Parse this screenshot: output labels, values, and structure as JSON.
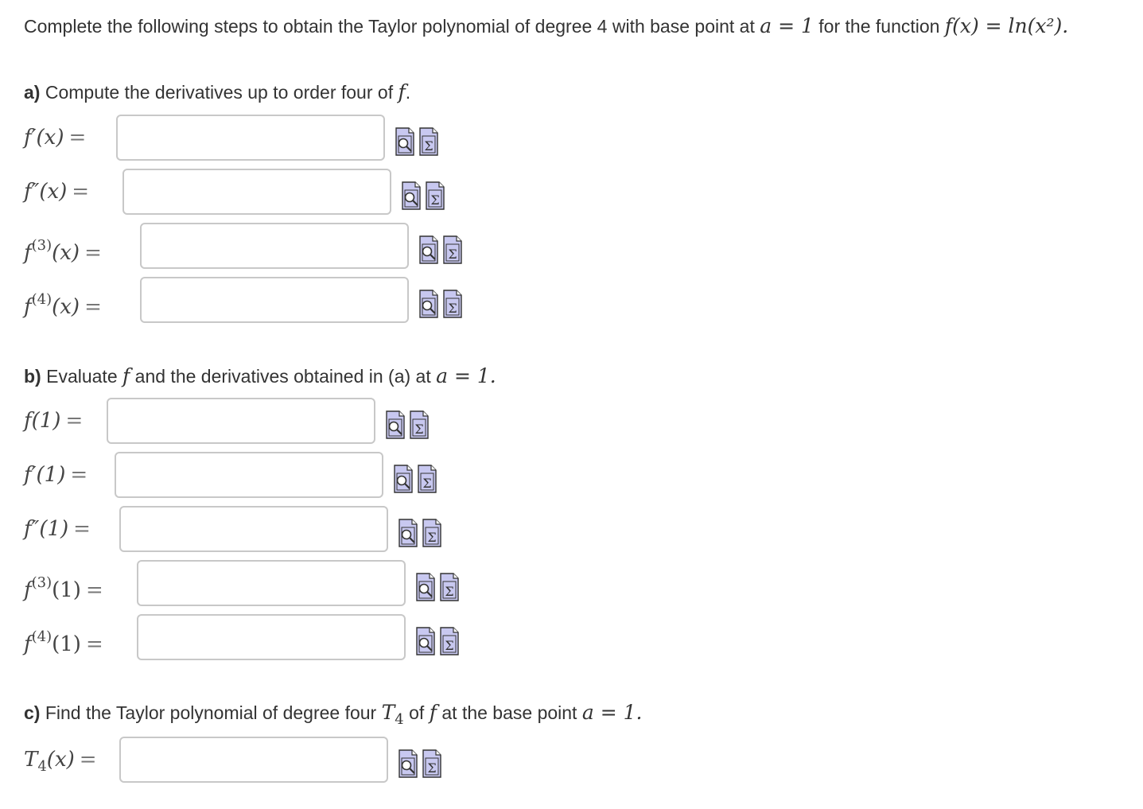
{
  "intro": {
    "text": "Complete the following steps to obtain the Taylor polynomial of degree 4 with base point at",
    "base_point": "a = 1",
    "mid_text": "for the function",
    "function": "f(x) = ln(x²)."
  },
  "sections": {
    "a": {
      "tag": "a)",
      "text": "Compute the derivatives up to order four of",
      "symbol": "f",
      "end": "."
    },
    "b": {
      "tag": "b)",
      "text_1": "Evaluate",
      "symbol": "f",
      "text_2": "and the derivatives obtained in (a) at",
      "point": "a = 1."
    },
    "c": {
      "tag": "c)",
      "text_1": "Find the Taylor polynomial of degree four",
      "poly": "T",
      "poly_sub": "4",
      "text_2": "of",
      "symbol": "f",
      "text_3": "at the base point",
      "point": "a = 1."
    }
  },
  "rows": {
    "d1": {
      "label": "f′(x)",
      "eq": "=",
      "value": ""
    },
    "d2": {
      "label": "f″(x)",
      "eq": "=",
      "value": ""
    },
    "d3": {
      "label_base": "f",
      "label_sup": "(3)",
      "label_arg": "(x)",
      "eq": "=",
      "value": ""
    },
    "d4": {
      "label_base": "f",
      "label_sup": "(4)",
      "label_arg": "(x)",
      "eq": "=",
      "value": ""
    },
    "e0": {
      "label": "f(1)",
      "eq": "=",
      "value": ""
    },
    "e1": {
      "label": "f′(1)",
      "eq": "=",
      "value": ""
    },
    "e2": {
      "label": "f″(1)",
      "eq": "=",
      "value": ""
    },
    "e3": {
      "label_base": "f",
      "label_sup": "(3)",
      "label_arg": "(1)",
      "eq": "=",
      "value": ""
    },
    "e4": {
      "label_base": "f",
      "label_sup": "(4)",
      "label_arg": "(1)",
      "eq": "=",
      "value": ""
    },
    "t4": {
      "label_base": "T",
      "label_sub": "4",
      "label_arg": "(x)",
      "eq": "=",
      "value": ""
    }
  },
  "icons": {
    "preview": "preview-icon",
    "equation_editor": "equation-editor-icon",
    "fill_color": "#c8c8f0",
    "stroke_color": "#333333"
  }
}
